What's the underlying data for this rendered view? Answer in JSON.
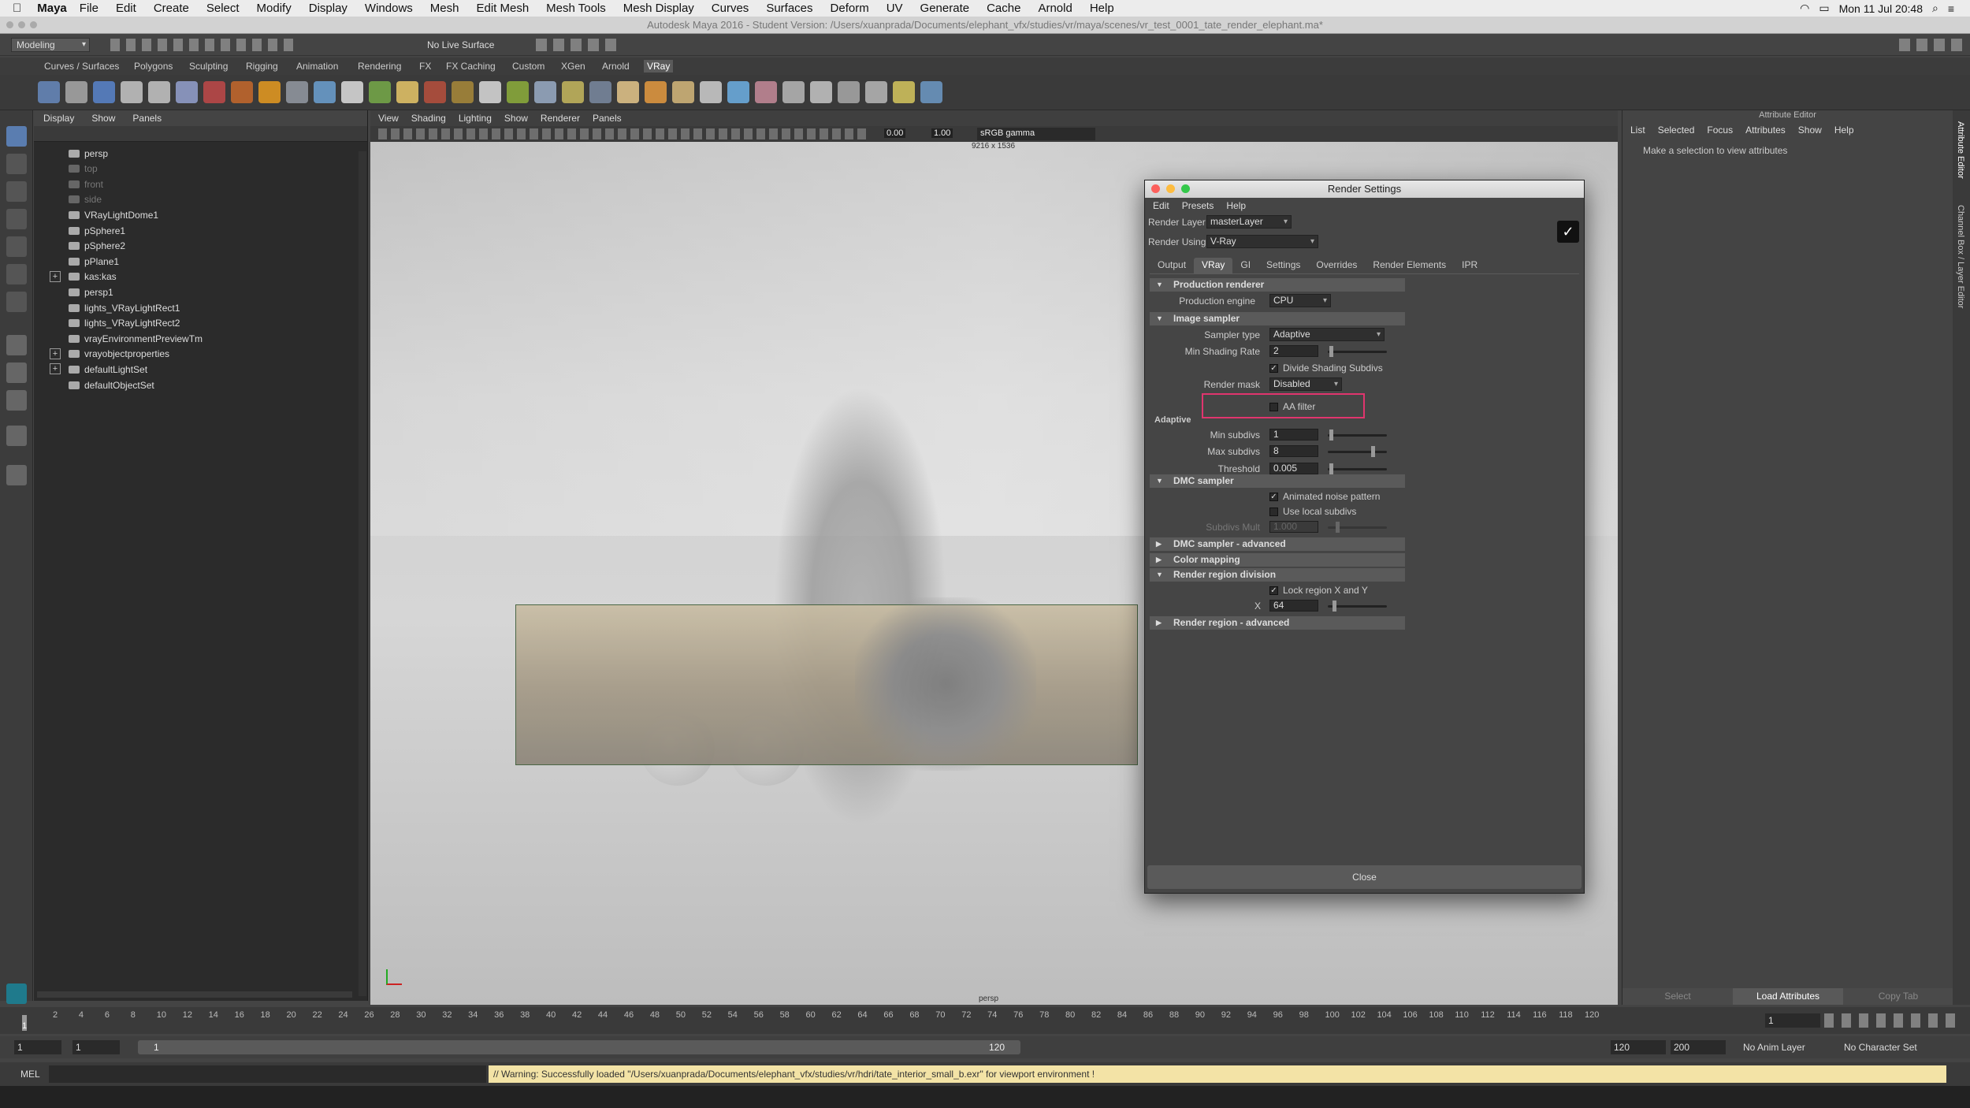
{
  "macbar": {
    "app": "Maya",
    "menus": [
      "File",
      "Edit",
      "Create",
      "Select",
      "Modify",
      "Display",
      "Windows",
      "Mesh",
      "Edit Mesh",
      "Mesh Tools",
      "Mesh Display",
      "Curves",
      "Surfaces",
      "Deform",
      "UV",
      "Generate",
      "Cache",
      "Arnold",
      "Help"
    ],
    "clock": "Mon 11 Jul  20:48"
  },
  "window_title": "Autodesk Maya 2016 - Student Version: /Users/xuanprada/Documents/elephant_vfx/studies/vr/maya/scenes/vr_test_0001_tate_render_elephant.ma*",
  "mode": "Modeling",
  "live_surface": "No Live Surface",
  "shelf_tabs": [
    "Curves / Surfaces",
    "Polygons",
    "Sculpting",
    "Rigging",
    "Animation",
    "Rendering",
    "FX",
    "FX Caching",
    "Custom",
    "XGen",
    "Arnold",
    "VRay"
  ],
  "outliner": {
    "menu": [
      "Display",
      "Show",
      "Panels"
    ],
    "items": [
      {
        "label": "persp",
        "dim": false
      },
      {
        "label": "top",
        "dim": true
      },
      {
        "label": "front",
        "dim": true
      },
      {
        "label": "side",
        "dim": true
      },
      {
        "label": "VRayLightDome1",
        "dim": false
      },
      {
        "label": "pSphere1",
        "dim": false
      },
      {
        "label": "pSphere2",
        "dim": false
      },
      {
        "label": "pPlane1",
        "dim": false
      },
      {
        "label": "kas:kas",
        "dim": false
      },
      {
        "label": "persp1",
        "dim": false
      },
      {
        "label": "lights_VRayLightRect1",
        "dim": false
      },
      {
        "label": "lights_VRayLightRect2",
        "dim": false
      },
      {
        "label": "vrayEnvironmentPreviewTm",
        "dim": false
      },
      {
        "label": "vrayobjectproperties",
        "dim": false
      },
      {
        "label": "defaultLightSet",
        "dim": false
      },
      {
        "label": "defaultObjectSet",
        "dim": false
      }
    ]
  },
  "viewport": {
    "menu": [
      "View",
      "Shading",
      "Lighting",
      "Show",
      "Renderer",
      "Panels"
    ],
    "val1": "0.00",
    "val2": "1.00",
    "color_space": "sRGB gamma",
    "resolution": "9216 x 1536",
    "camera": "persp"
  },
  "render_settings": {
    "title": "Render Settings",
    "menu": [
      "Edit",
      "Presets",
      "Help"
    ],
    "render_layer_label": "Render Layer",
    "render_layer": "masterLayer",
    "render_using_label": "Render Using",
    "render_using": "V-Ray",
    "tabs": [
      "Output",
      "VRay",
      "GI",
      "Settings",
      "Overrides",
      "Render Elements",
      "IPR"
    ],
    "sec_production": "Production renderer",
    "engine_label": "Production engine",
    "engine": "CPU",
    "sec_image_sampler": "Image sampler",
    "sampler_type_label": "Sampler type",
    "sampler_type": "Adaptive",
    "min_shading_label": "Min Shading Rate",
    "min_shading": "2",
    "divide_label": "Divide Shading Subdivs",
    "render_mask_label": "Render mask",
    "render_mask": "Disabled",
    "aa_filter_label": "AA filter",
    "adaptive_label": "Adaptive",
    "min_subdivs_label": "Min subdivs",
    "min_subdivs": "1",
    "max_subdivs_label": "Max subdivs",
    "max_subdivs": "8",
    "threshold_label": "Threshold",
    "threshold": "0.005",
    "sec_dmc": "DMC sampler",
    "anim_noise_label": "Animated noise pattern",
    "local_subdivs_label": "Use local subdivs",
    "subdivs_mult_label": "Subdivs Mult",
    "subdivs_mult": "1.000",
    "sec_dmc_adv": "DMC sampler - advanced",
    "sec_color": "Color mapping",
    "sec_region": "Render region division",
    "lock_label": "Lock region X and Y",
    "x_label": "X",
    "x_val": "64",
    "sec_region_adv": "Render region - advanced",
    "close": "Close"
  },
  "attribute_editor": {
    "header": "Attribute Editor",
    "menu": [
      "List",
      "Selected",
      "Focus",
      "Attributes",
      "Show",
      "Help"
    ],
    "message": "Make a selection to view attributes",
    "select": "Select",
    "load": "Load Attributes",
    "copy": "Copy Tab"
  },
  "side_tabs": [
    "Attribute Editor",
    "Channel Box / Layer Editor"
  ],
  "timeline": {
    "ticks": [
      "2",
      "4",
      "6",
      "8",
      "10",
      "12",
      "14",
      "16",
      "18",
      "20",
      "22",
      "24",
      "26",
      "28",
      "30",
      "32",
      "34",
      "36",
      "38",
      "40",
      "42",
      "44",
      "46",
      "48",
      "50",
      "52",
      "54",
      "56",
      "58",
      "60",
      "62",
      "64",
      "66",
      "68",
      "70",
      "72",
      "74",
      "76",
      "78",
      "80",
      "82",
      "84",
      "86",
      "88",
      "90",
      "92",
      "94",
      "96",
      "98",
      "100",
      "102",
      "104",
      "106",
      "108",
      "110",
      "112",
      "114",
      "116",
      "118",
      "120"
    ],
    "current_frame": "1",
    "cur_tick": "1"
  },
  "range": {
    "start": "1",
    "start2": "1",
    "slider_start": "1",
    "slider_end": "120",
    "end": "120",
    "end2": "200",
    "anim_layer": "No Anim Layer",
    "char_set": "No Character Set"
  },
  "command": {
    "label": "MEL",
    "warning": "// Warning: Successfully loaded \"/Users/xuanprada/Documents/elephant_vfx/studies/vr/hdri/tate_interior_small_b.exr\" for viewport environment !"
  }
}
